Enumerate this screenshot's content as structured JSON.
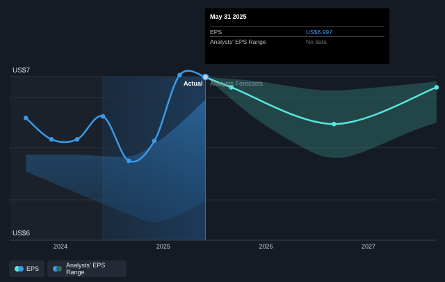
{
  "colors": {
    "background": "#151b24",
    "eps_line": "#3b9ae8",
    "forecast_line": "#58e6dd",
    "forecast_band": "#2e6a66",
    "actual_band": "#1f5c96",
    "grid": "#2b323d",
    "tooltip_value": "#3b9ae8"
  },
  "y_axis": {
    "top_label": "US$7",
    "bottom_label": "US$6"
  },
  "regions": {
    "actual_label": "Actual",
    "forecast_label": "Analysts Forecasts"
  },
  "tooltip": {
    "date": "May 31 2025",
    "rows": [
      {
        "key": "EPS",
        "value": "US$6.997"
      },
      {
        "key": "Analysts' EPS Range",
        "value": "No data"
      }
    ]
  },
  "legend": [
    {
      "label": "EPS",
      "icon": "eps-legend-icon",
      "color": "#3b9ae8"
    },
    {
      "label": "Analysts' EPS Range",
      "icon": "range-legend-icon",
      "color": "#58e6dd"
    }
  ],
  "chart_data": {
    "type": "line",
    "title": "",
    "xlabel": "",
    "ylabel": "",
    "x_ticks": [
      "2024",
      "2025",
      "2026",
      "2027"
    ],
    "ylim": [
      6.0,
      7.0
    ],
    "grid": true,
    "legend_placement": "bottom-left",
    "series": [
      {
        "name": "EPS",
        "x": [
          "2023-08-31",
          "2023-11-30",
          "2024-02-29",
          "2024-05-31",
          "2024-08-31",
          "2024-11-30",
          "2025-02-28",
          "2025-05-31"
        ],
        "y": [
          6.73,
          6.59,
          6.59,
          6.74,
          6.45,
          6.58,
          7.01,
          6.997
        ]
      },
      {
        "name": "Analysts' EPS Range",
        "x": [
          "2025-05-31",
          "2025-08-31",
          "2026-08-31",
          "2027-08-31"
        ],
        "y": [
          6.997,
          6.93,
          6.69,
          6.93
        ]
      }
    ],
    "actual_range_band": {
      "x": [
        "2023-08-31",
        "2024-02-29",
        "2024-08-31",
        "2024-11-30",
        "2025-02-28",
        "2025-05-31"
      ],
      "high": [
        6.49,
        6.49,
        6.48,
        6.56,
        6.69,
        6.85
      ],
      "low": [
        6.38,
        6.24,
        6.1,
        6.05,
        6.1,
        6.19
      ]
    },
    "forecast_band": {
      "x": [
        "2025-05-31",
        "2025-11-30",
        "2026-05-31",
        "2026-08-31",
        "2026-11-30",
        "2027-05-31",
        "2027-08-31"
      ],
      "high": [
        6.997,
        6.97,
        6.92,
        6.91,
        6.92,
        6.95,
        6.97
      ],
      "low": [
        6.997,
        6.72,
        6.52,
        6.47,
        6.5,
        6.64,
        6.7
      ]
    }
  }
}
